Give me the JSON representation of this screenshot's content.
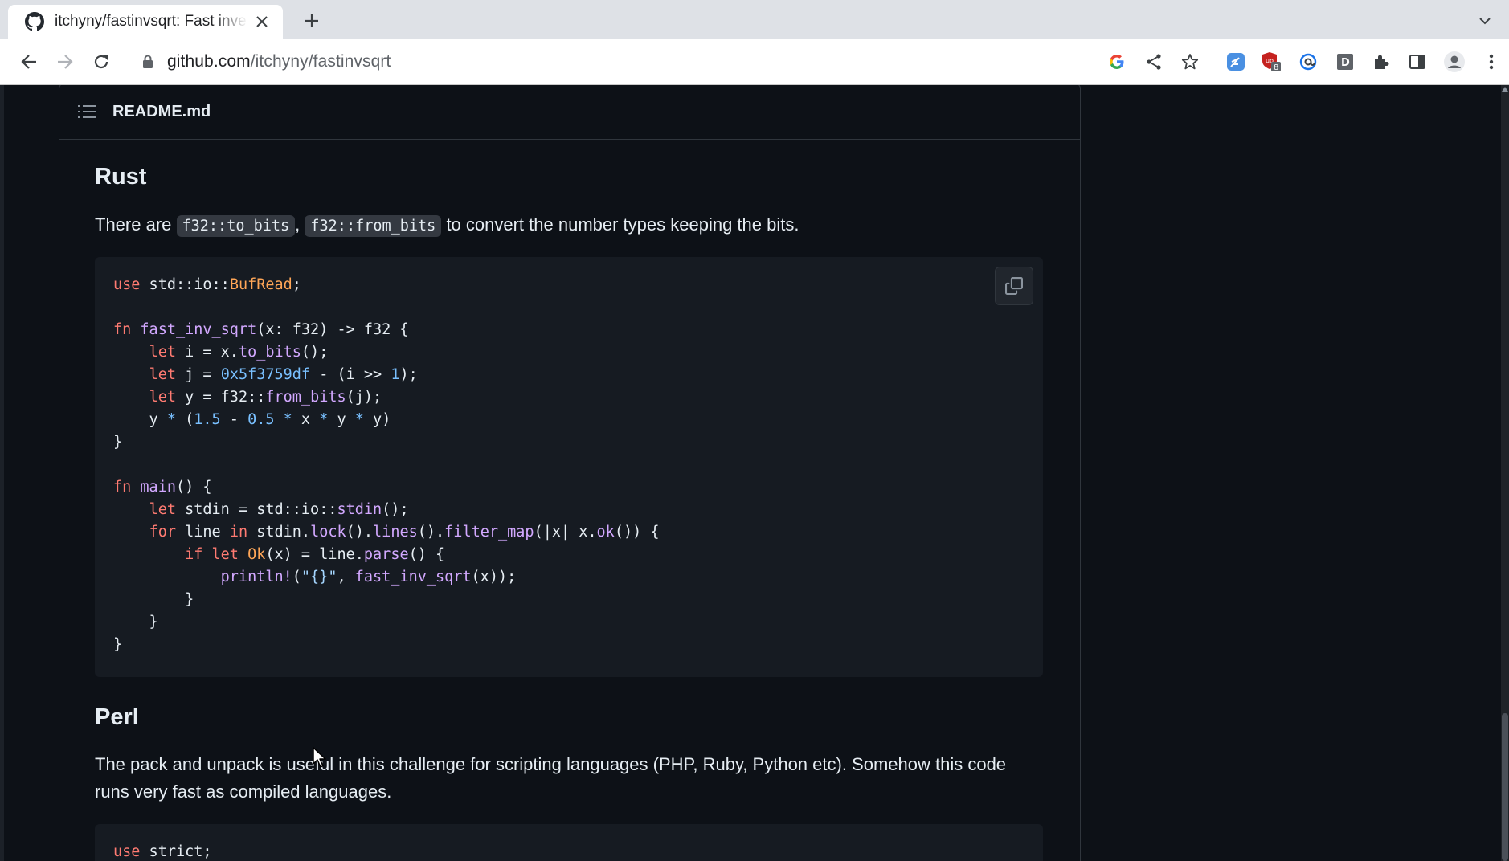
{
  "browser": {
    "tab_title": "itchyny/fastinvsqrt: Fast inverse square root",
    "url_host": "github.com",
    "url_path": "/itchyny/fastinvsqrt",
    "extension_badge": "8",
    "ext_d_label": "D"
  },
  "readme": {
    "file_name": "README.md"
  },
  "sections": {
    "rust": {
      "heading": "Rust",
      "para_before": "There are ",
      "code1": "f32::to_bits",
      "para_sep": ", ",
      "code2": "f32::from_bits",
      "para_after": " to convert the number types keeping the bits.",
      "code_lines": [
        "use std::io::BufRead;",
        "",
        "fn fast_inv_sqrt(x: f32) -> f32 {",
        "    let i = x.to_bits();",
        "    let j = 0x5f3759df - (i >> 1);",
        "    let y = f32::from_bits(j);",
        "    y * (1.5 - 0.5 * x * y * y)",
        "}",
        "",
        "fn main() {",
        "    let stdin = std::io::stdin();",
        "    for line in stdin.lock().lines().filter_map(|x| x.ok()) {",
        "        if let Ok(x) = line.parse() {",
        "            println!(\"{}\", fast_inv_sqrt(x));",
        "        }",
        "    }",
        "}"
      ]
    },
    "perl": {
      "heading": "Perl",
      "paragraph": "The pack and unpack is useful in this challenge for scripting languages (PHP, Ruby, Python etc). Somehow this code runs very fast as compiled languages.",
      "code_lines": [
        "use strict;"
      ]
    }
  },
  "icons": {
    "tab_favicon": "github-icon",
    "tab_close": "close-icon",
    "new_tab": "plus-icon",
    "tab_search": "chevron-down-icon",
    "back": "back-arrow-icon",
    "forward": "forward-arrow-icon",
    "reload": "reload-icon",
    "lock": "lock-icon",
    "google": "google-icon",
    "share": "share-icon",
    "bookmark": "star-icon",
    "ext1": "extension-feather-icon",
    "ext2": "ublock-icon",
    "ext3": "extension-at-icon",
    "ext4": "extension-d-icon",
    "extensions": "puzzle-icon",
    "side_panel": "side-panel-icon",
    "profile": "profile-icon",
    "menu": "kebab-menu-icon",
    "toc": "list-icon",
    "copy": "copy-icon"
  },
  "colors": {
    "page_bg": "#0d1117",
    "code_bg": "#161b22",
    "keyword": "#ff7b72",
    "function": "#d2a8ff",
    "type": "#ffa657",
    "number": "#79c0ff"
  }
}
